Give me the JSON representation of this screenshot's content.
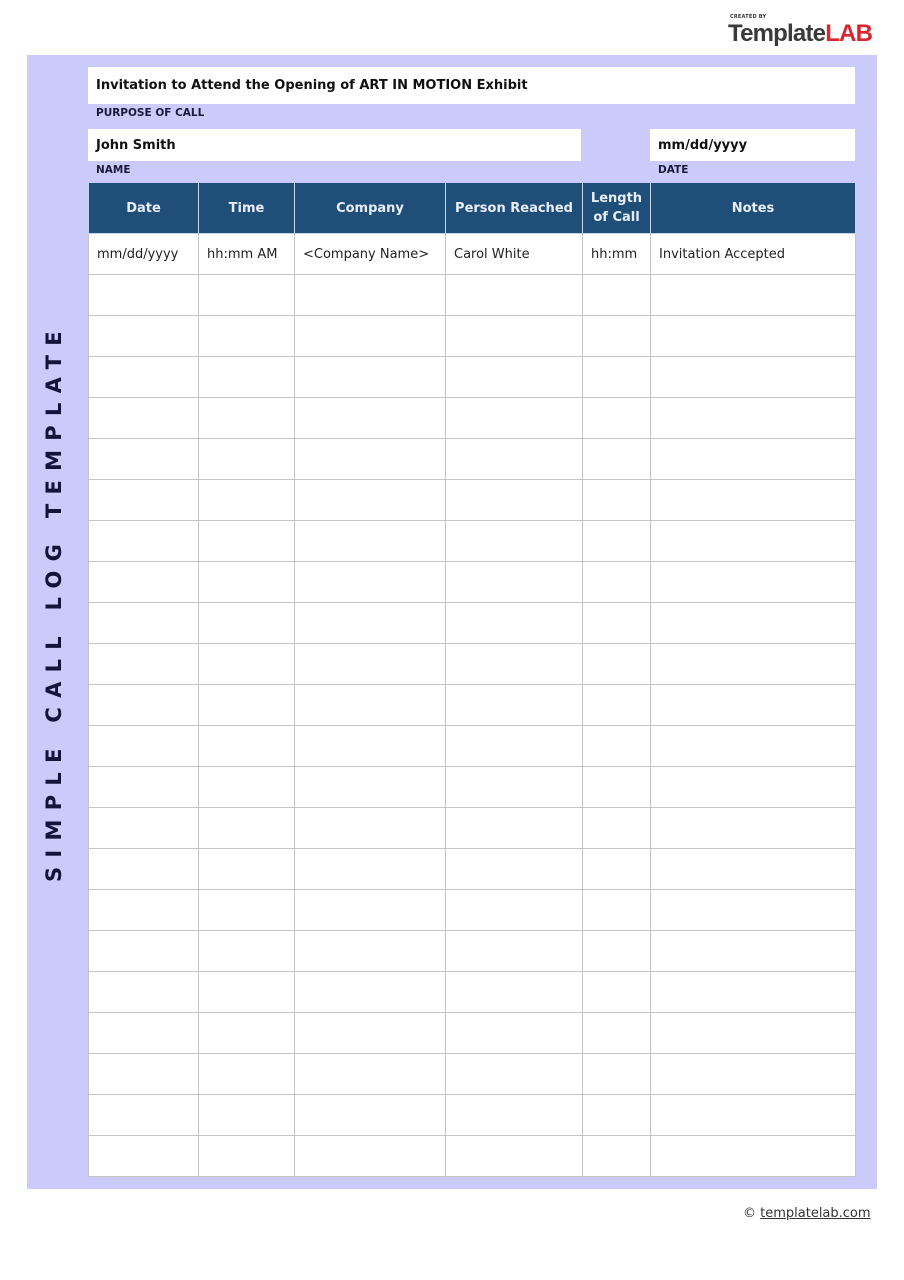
{
  "logo": {
    "created_by": "CREATED BY",
    "brand_part1": "Template",
    "brand_part2": "LAB"
  },
  "side_title": "SIMPLE CALL LOG TEMPLATE",
  "purpose": {
    "value": "Invitation to Attend the Opening of ART IN MOTION Exhibit",
    "label": "PURPOSE OF CALL"
  },
  "name": {
    "value": "John Smith",
    "label": "NAME"
  },
  "date": {
    "value": "mm/dd/yyyy",
    "label": "DATE"
  },
  "table": {
    "headers": [
      "Date",
      "Time",
      "Company",
      "Person Reached",
      "Length of Call",
      "Notes"
    ],
    "header_line2": {
      "4": "of Call"
    },
    "rows": [
      [
        "mm/dd/yyyy",
        "hh:mm AM",
        "<Company Name>",
        "Carol White",
        "hh:mm",
        "Invitation Accepted"
      ],
      [
        "",
        "",
        "",
        "",
        "",
        ""
      ],
      [
        "",
        "",
        "",
        "",
        "",
        ""
      ],
      [
        "",
        "",
        "",
        "",
        "",
        ""
      ],
      [
        "",
        "",
        "",
        "",
        "",
        ""
      ],
      [
        "",
        "",
        "",
        "",
        "",
        ""
      ],
      [
        "",
        "",
        "",
        "",
        "",
        ""
      ],
      [
        "",
        "",
        "",
        "",
        "",
        ""
      ],
      [
        "",
        "",
        "",
        "",
        "",
        ""
      ],
      [
        "",
        "",
        "",
        "",
        "",
        ""
      ],
      [
        "",
        "",
        "",
        "",
        "",
        ""
      ],
      [
        "",
        "",
        "",
        "",
        "",
        ""
      ],
      [
        "",
        "",
        "",
        "",
        "",
        ""
      ],
      [
        "",
        "",
        "",
        "",
        "",
        ""
      ],
      [
        "",
        "",
        "",
        "",
        "",
        ""
      ],
      [
        "",
        "",
        "",
        "",
        "",
        ""
      ],
      [
        "",
        "",
        "",
        "",
        "",
        ""
      ],
      [
        "",
        "",
        "",
        "",
        "",
        ""
      ],
      [
        "",
        "",
        "",
        "",
        "",
        ""
      ],
      [
        "",
        "",
        "",
        "",
        "",
        ""
      ],
      [
        "",
        "",
        "",
        "",
        "",
        ""
      ],
      [
        "",
        "",
        "",
        "",
        "",
        ""
      ],
      [
        "",
        "",
        "",
        "",
        "",
        ""
      ]
    ]
  },
  "footer": {
    "copyright": "©",
    "link": "templatelab.com"
  },
  "colors": {
    "panel": "#cbcbfb",
    "header": "#1f4e79",
    "brand_red": "#d7262f"
  }
}
